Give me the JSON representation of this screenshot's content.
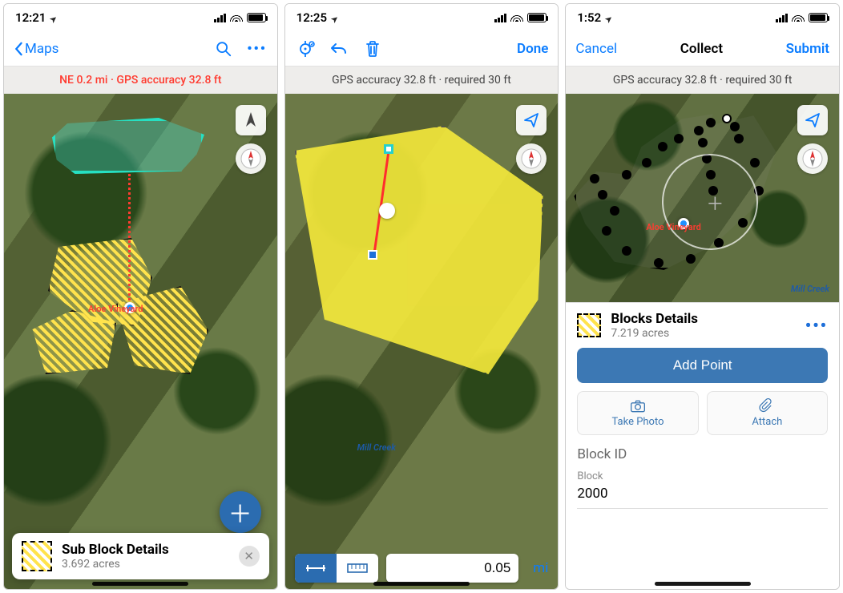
{
  "phone1": {
    "status_time": "12:21",
    "nav_back": "Maps",
    "banner": "NE 0.2 mi · GPS accuracy 32.8 ft",
    "vineyard_label": "Aloe Vineyard",
    "card_title": "Sub Block Details",
    "card_sub": "3.692 acres"
  },
  "phone2": {
    "status_time": "12:25",
    "done": "Done",
    "banner": "GPS accuracy 32.8 ft · required 30 ft",
    "creek_label": "Mill Creek",
    "dist_value": "0.05",
    "dist_unit": "mi"
  },
  "phone3": {
    "status_time": "1:52",
    "cancel": "Cancel",
    "title": "Collect",
    "submit": "Submit",
    "banner": "GPS accuracy 32.8 ft · required 30 ft",
    "vineyard_label": "Aloe Vineyard",
    "creek_label": "Mill Creek",
    "card_title": "Blocks Details",
    "card_sub": "7.219 acres",
    "add_point": "Add Point",
    "take_photo": "Take Photo",
    "attach": "Attach",
    "field_header": "Block ID",
    "field_label": "Block",
    "field_value": "2000"
  }
}
